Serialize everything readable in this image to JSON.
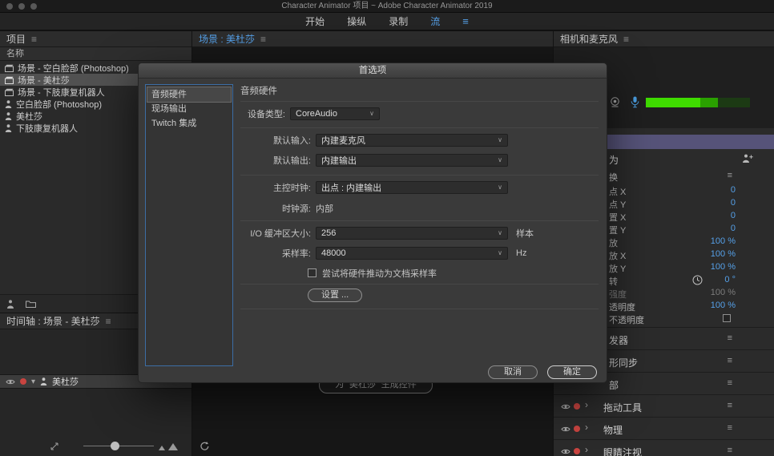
{
  "colors": {
    "accent_blue": "#55a0e8",
    "meter_green": "#3fdb00",
    "record_red": "#c94440",
    "behavior_header_purple": "#565379"
  },
  "icons": {
    "panel_menu": "≡",
    "dropdown_chevron": "∨",
    "collapse": "▾",
    "chevron": "›"
  },
  "titlebar": {
    "title": "Character Animator 项目 ~ Adobe Character Animator 2019"
  },
  "workspace": {
    "tabs": [
      "开始",
      "操纵",
      "录制",
      "流"
    ]
  },
  "project": {
    "title": "项目",
    "name_column": "名称",
    "items": [
      {
        "label": "场景 - 空白脸部 (Photoshop)"
      },
      {
        "label": "场景 - 美杜莎"
      },
      {
        "label": "场景 - 下肢康复机器人"
      },
      {
        "label": "空白脸部 (Photoshop)"
      },
      {
        "label": "美杜莎"
      },
      {
        "label": "下肢康复机器人"
      }
    ]
  },
  "scene": {
    "title": "场景 : 美杜莎",
    "generate_button_label": "为 “美杜莎” 生成控件"
  },
  "camera": {
    "title": "相机和麦克风"
  },
  "properties": {
    "behavior_fragment": "为",
    "transform_fragment": "换",
    "rows": [
      {
        "label": "点 X",
        "value": "0"
      },
      {
        "label": "点 Y",
        "value": "0"
      },
      {
        "label": "置 X",
        "value": "0"
      },
      {
        "label": "置 Y",
        "value": "0"
      },
      {
        "label": "放",
        "value": "100 %"
      },
      {
        "label": "放 X",
        "value": "100 %"
      },
      {
        "label": "放 Y",
        "value": "100 %"
      },
      {
        "label": "转",
        "value": "0 °"
      },
      {
        "label": "强度",
        "value": "100 %"
      },
      {
        "label": "透明度",
        "value": "100 %"
      },
      {
        "label": "不透明度",
        "value": ""
      }
    ],
    "sections": [
      {
        "label": "发器"
      },
      {
        "label": "形同步"
      },
      {
        "label": "部"
      },
      {
        "label": "拖动工具"
      },
      {
        "label": "物理"
      },
      {
        "label": "眼睛注视"
      }
    ]
  },
  "timeline": {
    "title": "时间轴 : 场景 - 美杜莎",
    "track_label": "美杜莎"
  },
  "dialog": {
    "title": "首选项",
    "nav": [
      {
        "label": "音频硬件"
      },
      {
        "label": "现场输出"
      },
      {
        "label": "Twitch 集成"
      }
    ],
    "section_title": "音频硬件",
    "device_type": {
      "label": "设备类型:",
      "value": "CoreAudio"
    },
    "default_input": {
      "label": "默认输入:",
      "value": "内建麦克风"
    },
    "default_output": {
      "label": "默认输出:",
      "value": "内建输出"
    },
    "master_clock": {
      "label": "主控时钟:",
      "value": "出点 : 内建输出"
    },
    "clock_source": {
      "label": "时钟源:",
      "value": "内部"
    },
    "io_buffer": {
      "label": "I/O 缓冲区大小:",
      "value": "256",
      "suffix": "样本"
    },
    "sample_rate": {
      "label": "采样率:",
      "value": "48000",
      "suffix": "Hz"
    },
    "checkbox_label": "尝试将硬件推动为文档采样率",
    "settings_button": "设置 ...",
    "cancel_button": "取消",
    "ok_button": "确定"
  }
}
